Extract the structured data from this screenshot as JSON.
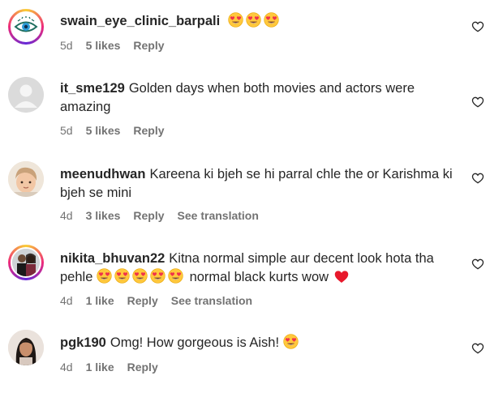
{
  "comments": [
    {
      "username": "swain_eye_clinic_barpali",
      "text": "",
      "emoji_count": 3,
      "time": "5d",
      "likes": "5 likes",
      "reply": "Reply",
      "see_translation": ""
    },
    {
      "username": "it_sme129",
      "text": "Golden days when both movies and actors were amazing",
      "time": "5d",
      "likes": "5 likes",
      "reply": "Reply",
      "see_translation": ""
    },
    {
      "username": "meenudhwan",
      "text": "Kareena ki bjeh se hi parral chle the or Karishma ki bjeh se mini",
      "time": "4d",
      "likes": "3 likes",
      "reply": "Reply",
      "see_translation": "See translation"
    },
    {
      "username": "nikita_bhuvan22",
      "text_before": "Kitna normal simple aur decent look hota tha pehle",
      "emoji_count": 5,
      "text_after": "normal black kurts wow",
      "time": "4d",
      "likes": "1 like",
      "reply": "Reply",
      "see_translation": "See translation"
    },
    {
      "username": "pgk190",
      "text": "Omg! How gorgeous is Aish!",
      "emoji_count": 1,
      "time": "4d",
      "likes": "1 like",
      "reply": "Reply",
      "see_translation": ""
    }
  ],
  "icons": {
    "like": "heart-outline-icon",
    "emoji": "smiling-face-with-heart-eyes-emoji",
    "red_heart": "red-heart-emoji"
  },
  "colors": {
    "text": "#262626",
    "meta": "#737373",
    "emoji_face": "#ffc83d",
    "emoji_heart": "#f0324b",
    "red_heart": "#e8192c"
  }
}
